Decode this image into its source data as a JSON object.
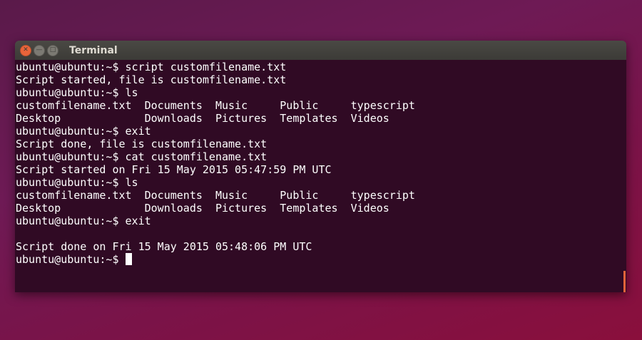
{
  "window": {
    "title": "Terminal"
  },
  "terminal": {
    "lines": [
      "ubuntu@ubuntu:~$ script customfilename.txt",
      "Script started, file is customfilename.txt",
      "ubuntu@ubuntu:~$ ls",
      "customfilename.txt  Documents  Music     Public     typescript",
      "Desktop             Downloads  Pictures  Templates  Videos",
      "ubuntu@ubuntu:~$ exit",
      "Script done, file is customfilename.txt",
      "ubuntu@ubuntu:~$ cat customfilename.txt",
      "Script started on Fri 15 May 2015 05:47:59 PM UTC",
      "ubuntu@ubuntu:~$ ls",
      "customfilename.txt  Documents  Music     Public     typescript",
      "Desktop             Downloads  Pictures  Templates  Videos",
      "ubuntu@ubuntu:~$ exit",
      "",
      "Script done on Fri 15 May 2015 05:48:06 PM UTC"
    ],
    "prompt": "ubuntu@ubuntu:~$ "
  },
  "icons": {
    "close": "close-icon",
    "minimize": "minimize-icon",
    "maximize": "maximize-icon"
  }
}
